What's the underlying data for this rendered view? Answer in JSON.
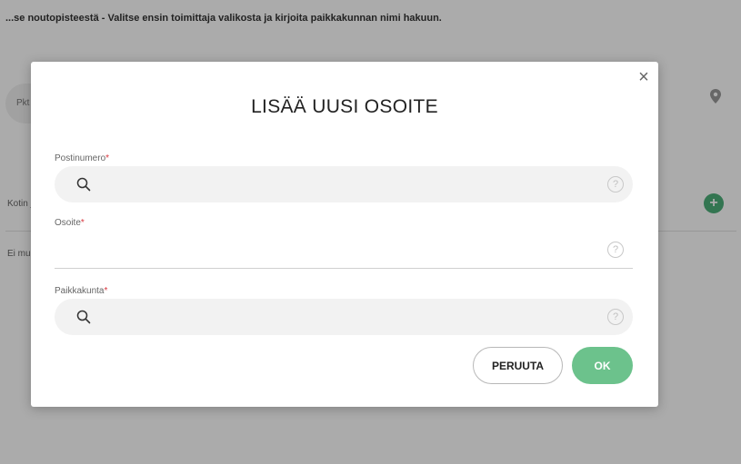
{
  "background": {
    "hint_text": "...se noutopisteestä - Valitse ensin toimittaja valikosta ja kirjoita paikkakunnan nimi hakuun.",
    "field_placeholder": "Pkt",
    "row1_text": "Kotin j",
    "row2_text": "Ei mui",
    "add_icon_glyph": "+",
    "colors": {
      "accent": "#4caf7a"
    }
  },
  "modal": {
    "title": "LISÄÄ UUSI OSOITE",
    "close_glyph": "×",
    "fields": [
      {
        "label": "Postinumero",
        "required_mark": "*",
        "value": "",
        "icon": "search-icon",
        "help_glyph": "?"
      },
      {
        "label": "Osoite",
        "required_mark": "*",
        "value": "",
        "help_glyph": "?"
      },
      {
        "label": "Paikkakunta",
        "required_mark": "*",
        "value": "",
        "icon": "search-icon",
        "help_glyph": "?"
      }
    ],
    "buttons": {
      "cancel": "PERUUTA",
      "ok": "OK"
    },
    "colors": {
      "ok_button": "#6cc28c",
      "required": "#d9363e"
    }
  }
}
